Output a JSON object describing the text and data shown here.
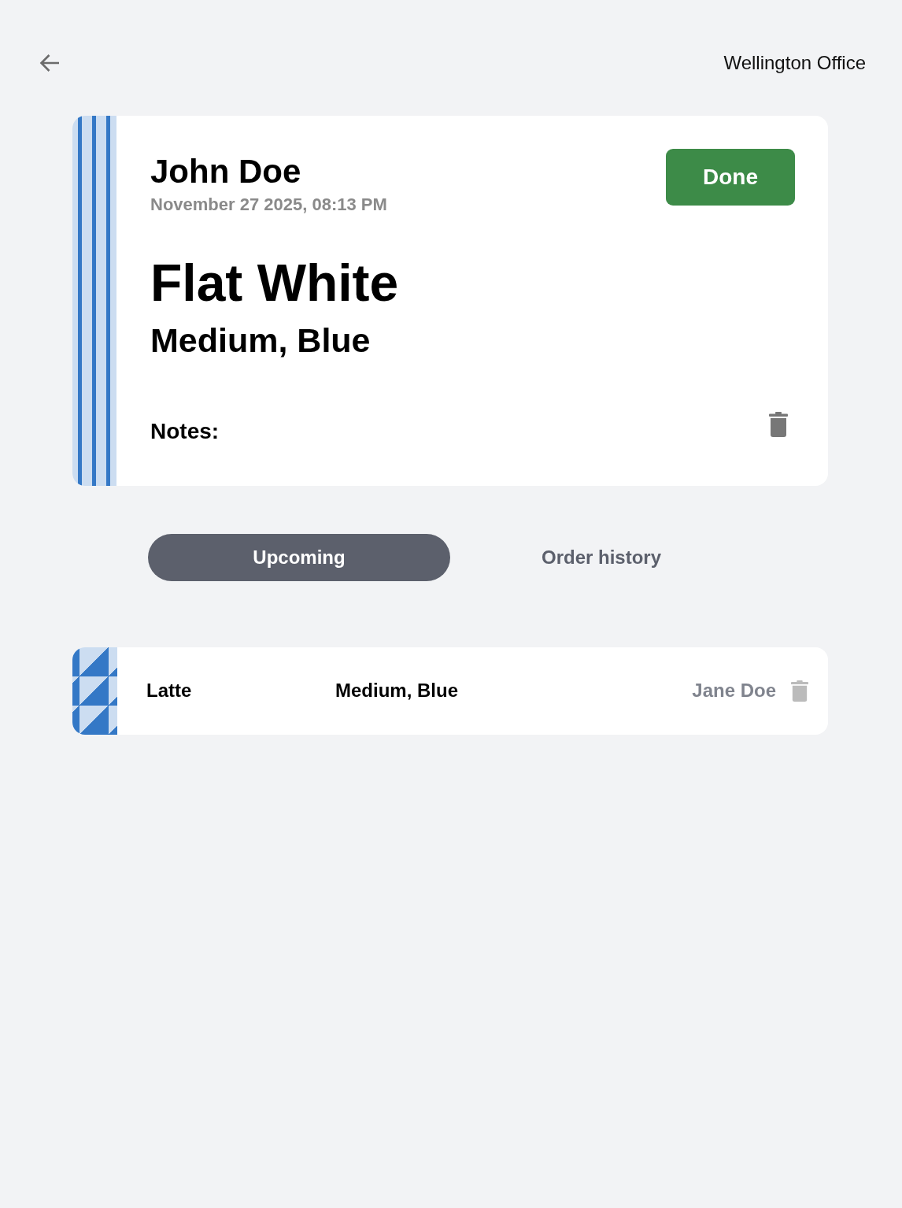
{
  "location": "Wellington Office",
  "current_order": {
    "customer": "John Doe",
    "time": "November 27 2025, 08:13 PM",
    "drink": "Flat White",
    "options": "Medium, Blue",
    "notes_label": "Notes:",
    "action": "Done",
    "kind": "stripes",
    "color": "#3478c6"
  },
  "tabs": [
    {
      "label": "Upcoming",
      "selected": true
    },
    {
      "label": "Order history",
      "selected": false
    }
  ],
  "orders": [
    {
      "drink": "Latte",
      "options": "Medium, Blue",
      "customer": "Jane Doe",
      "kind": "triangles",
      "color": "#3478c6"
    }
  ]
}
